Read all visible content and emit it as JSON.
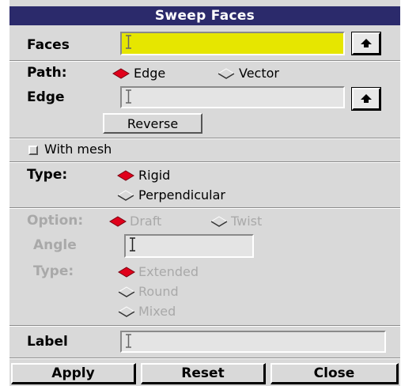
{
  "window": {
    "title": "Sweep Faces"
  },
  "faces": {
    "label": "Faces",
    "value": ""
  },
  "path": {
    "label": "Path:",
    "options": [
      "Edge",
      "Vector"
    ],
    "selected": "Edge"
  },
  "edge": {
    "label": "Edge",
    "value": "",
    "reverse_label": "Reverse"
  },
  "mesh": {
    "label": "With mesh",
    "checked": false
  },
  "type": {
    "label": "Type:",
    "options": [
      "Rigid",
      "Perpendicular"
    ],
    "selected": "Rigid"
  },
  "option": {
    "label": "Option:",
    "options": [
      "Draft",
      "Twist"
    ],
    "selected": "Draft",
    "enabled": false
  },
  "angle": {
    "label": "Angle",
    "value": ""
  },
  "draft_type": {
    "label": "Type:",
    "options": [
      "Extended",
      "Round",
      "Mixed"
    ],
    "selected": "Extended"
  },
  "label_field": {
    "label": "Label",
    "value": ""
  },
  "buttons": {
    "apply": "Apply",
    "reset": "Reset",
    "close": "Close"
  },
  "colors": {
    "title_bg": "#2b2a6b",
    "highlight_field": "#e6e600",
    "radio_selected": "#e0001b",
    "panel_bg": "#d9d9d9"
  },
  "icons": {
    "pick": "up-arrow-icon",
    "cursor": "text-cursor-icon"
  }
}
